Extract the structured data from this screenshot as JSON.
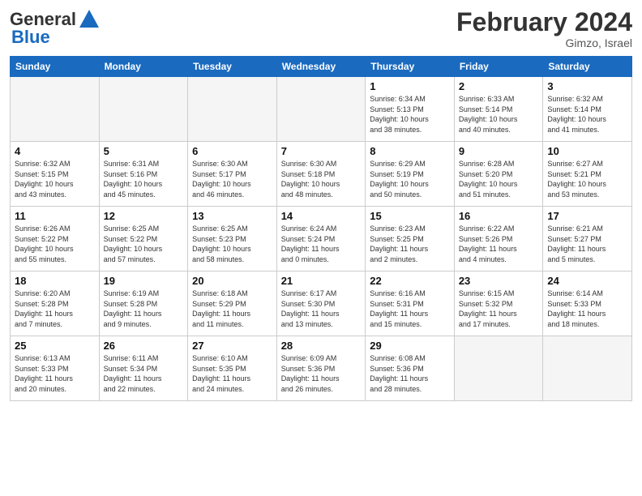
{
  "header": {
    "logo_general": "General",
    "logo_blue": "Blue",
    "month_title": "February 2024",
    "location": "Gimzo, Israel"
  },
  "columns": [
    "Sunday",
    "Monday",
    "Tuesday",
    "Wednesday",
    "Thursday",
    "Friday",
    "Saturday"
  ],
  "weeks": [
    [
      {
        "day": "",
        "info": "",
        "empty": true
      },
      {
        "day": "",
        "info": "",
        "empty": true
      },
      {
        "day": "",
        "info": "",
        "empty": true
      },
      {
        "day": "",
        "info": "",
        "empty": true
      },
      {
        "day": "1",
        "info": "Sunrise: 6:34 AM\nSunset: 5:13 PM\nDaylight: 10 hours\nand 38 minutes."
      },
      {
        "day": "2",
        "info": "Sunrise: 6:33 AM\nSunset: 5:14 PM\nDaylight: 10 hours\nand 40 minutes."
      },
      {
        "day": "3",
        "info": "Sunrise: 6:32 AM\nSunset: 5:14 PM\nDaylight: 10 hours\nand 41 minutes."
      }
    ],
    [
      {
        "day": "4",
        "info": "Sunrise: 6:32 AM\nSunset: 5:15 PM\nDaylight: 10 hours\nand 43 minutes."
      },
      {
        "day": "5",
        "info": "Sunrise: 6:31 AM\nSunset: 5:16 PM\nDaylight: 10 hours\nand 45 minutes."
      },
      {
        "day": "6",
        "info": "Sunrise: 6:30 AM\nSunset: 5:17 PM\nDaylight: 10 hours\nand 46 minutes."
      },
      {
        "day": "7",
        "info": "Sunrise: 6:30 AM\nSunset: 5:18 PM\nDaylight: 10 hours\nand 48 minutes."
      },
      {
        "day": "8",
        "info": "Sunrise: 6:29 AM\nSunset: 5:19 PM\nDaylight: 10 hours\nand 50 minutes."
      },
      {
        "day": "9",
        "info": "Sunrise: 6:28 AM\nSunset: 5:20 PM\nDaylight: 10 hours\nand 51 minutes."
      },
      {
        "day": "10",
        "info": "Sunrise: 6:27 AM\nSunset: 5:21 PM\nDaylight: 10 hours\nand 53 minutes."
      }
    ],
    [
      {
        "day": "11",
        "info": "Sunrise: 6:26 AM\nSunset: 5:22 PM\nDaylight: 10 hours\nand 55 minutes."
      },
      {
        "day": "12",
        "info": "Sunrise: 6:25 AM\nSunset: 5:22 PM\nDaylight: 10 hours\nand 57 minutes."
      },
      {
        "day": "13",
        "info": "Sunrise: 6:25 AM\nSunset: 5:23 PM\nDaylight: 10 hours\nand 58 minutes."
      },
      {
        "day": "14",
        "info": "Sunrise: 6:24 AM\nSunset: 5:24 PM\nDaylight: 11 hours\nand 0 minutes."
      },
      {
        "day": "15",
        "info": "Sunrise: 6:23 AM\nSunset: 5:25 PM\nDaylight: 11 hours\nand 2 minutes."
      },
      {
        "day": "16",
        "info": "Sunrise: 6:22 AM\nSunset: 5:26 PM\nDaylight: 11 hours\nand 4 minutes."
      },
      {
        "day": "17",
        "info": "Sunrise: 6:21 AM\nSunset: 5:27 PM\nDaylight: 11 hours\nand 5 minutes."
      }
    ],
    [
      {
        "day": "18",
        "info": "Sunrise: 6:20 AM\nSunset: 5:28 PM\nDaylight: 11 hours\nand 7 minutes."
      },
      {
        "day": "19",
        "info": "Sunrise: 6:19 AM\nSunset: 5:28 PM\nDaylight: 11 hours\nand 9 minutes."
      },
      {
        "day": "20",
        "info": "Sunrise: 6:18 AM\nSunset: 5:29 PM\nDaylight: 11 hours\nand 11 minutes."
      },
      {
        "day": "21",
        "info": "Sunrise: 6:17 AM\nSunset: 5:30 PM\nDaylight: 11 hours\nand 13 minutes."
      },
      {
        "day": "22",
        "info": "Sunrise: 6:16 AM\nSunset: 5:31 PM\nDaylight: 11 hours\nand 15 minutes."
      },
      {
        "day": "23",
        "info": "Sunrise: 6:15 AM\nSunset: 5:32 PM\nDaylight: 11 hours\nand 17 minutes."
      },
      {
        "day": "24",
        "info": "Sunrise: 6:14 AM\nSunset: 5:33 PM\nDaylight: 11 hours\nand 18 minutes."
      }
    ],
    [
      {
        "day": "25",
        "info": "Sunrise: 6:13 AM\nSunset: 5:33 PM\nDaylight: 11 hours\nand 20 minutes."
      },
      {
        "day": "26",
        "info": "Sunrise: 6:11 AM\nSunset: 5:34 PM\nDaylight: 11 hours\nand 22 minutes."
      },
      {
        "day": "27",
        "info": "Sunrise: 6:10 AM\nSunset: 5:35 PM\nDaylight: 11 hours\nand 24 minutes."
      },
      {
        "day": "28",
        "info": "Sunrise: 6:09 AM\nSunset: 5:36 PM\nDaylight: 11 hours\nand 26 minutes."
      },
      {
        "day": "29",
        "info": "Sunrise: 6:08 AM\nSunset: 5:36 PM\nDaylight: 11 hours\nand 28 minutes."
      },
      {
        "day": "",
        "info": "",
        "empty": true
      },
      {
        "day": "",
        "info": "",
        "empty": true
      }
    ]
  ]
}
